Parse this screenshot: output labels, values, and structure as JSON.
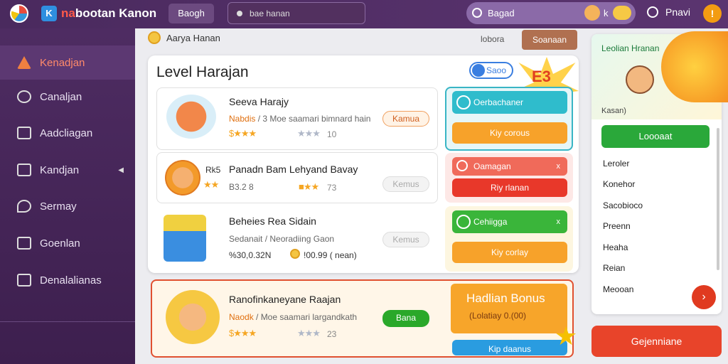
{
  "topbar": {
    "brand_prefix": "na",
    "brand_rest": "bootan Kanon",
    "nav_button": "Baogh",
    "input_value": "bae hanan",
    "search_value": "Bagad",
    "x_glyph": "k",
    "profile_label": "Pnavi"
  },
  "sidebar": {
    "items": [
      {
        "label": "Kenadjan"
      },
      {
        "label": "Canaljan"
      },
      {
        "label": "Aadcliagan"
      },
      {
        "label": "Kandjan"
      },
      {
        "label": "Sermay"
      },
      {
        "label": "Goenlan"
      },
      {
        "label": "Denalalianas"
      }
    ]
  },
  "crumb": {
    "title": "Aarya Hanan",
    "right_text": "lobora",
    "button": "Soanaan"
  },
  "main": {
    "title": "Level Harajan",
    "pill": "Saoo",
    "burst": "E3"
  },
  "rows": [
    {
      "title": "Seeva Harajy",
      "meta_hl": "Nabdis",
      "meta_rest": " / 3 Moe saamari bimnard hain",
      "stat": "10",
      "button": "Kamua"
    },
    {
      "prefix": "Rk5",
      "title": "Panadn Bam Lehyand Bavay",
      "meta": "B3.2 8",
      "stat": "73",
      "button": "Kemus"
    },
    {
      "title": "Beheies Rea Sidain",
      "meta": "Sedanait / Neoradiing Gaon",
      "price": "%30,0.32N",
      "stat": "!00.99 ( nean)",
      "button": "Kemus"
    }
  ],
  "actions": [
    {
      "top": "Oerbachaner",
      "bottom": "Kiy corous"
    },
    {
      "top": "Oamagan",
      "top_right": "x",
      "bottom": "Riy rlanan"
    },
    {
      "top": "Cehiigga",
      "top_right": "x",
      "bottom": "Kiy corlay"
    }
  ],
  "featured": {
    "title": "Ranofinkaneyane Raajan",
    "meta_hl": "Naodk",
    "meta_rest": " / Moe saamari largandkath",
    "stat": "23",
    "button": "Bana",
    "bonus_title": "Hadlian Bonus",
    "bonus_sub": "(Lolatiay 0.(00)",
    "bonus_action": "Kip daanus"
  },
  "right": {
    "title": "Leolian Hranan",
    "subtitle": "Kasan)",
    "button": "Loooaat",
    "list": [
      "Leroler",
      "Konehor",
      "Sacobioco",
      "Preenn",
      "Heaha",
      "Reian",
      "Meooan"
    ],
    "round_button": "›"
  },
  "bottom_button": "Gejenniane",
  "colors": {
    "accent": "#4e2c62",
    "orange": "#f7a52a",
    "green": "#2aa83a",
    "red": "#e8442a"
  }
}
